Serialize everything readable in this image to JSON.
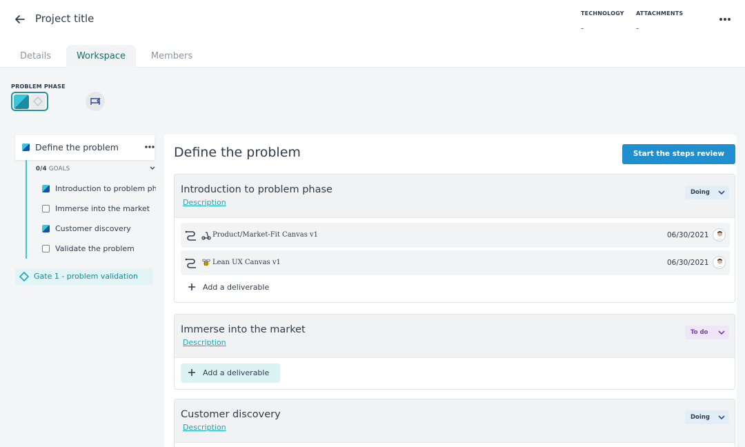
{
  "header": {
    "title": "Project title",
    "technology_label": "TECHNOLOGY",
    "technology_value": "-",
    "attachments_label": "ATTACHMENTS",
    "attachments_value": "-"
  },
  "tabs": [
    {
      "label": "Details",
      "active": false
    },
    {
      "label": "Workspace",
      "active": true
    },
    {
      "label": "Members",
      "active": false
    }
  ],
  "phase": {
    "label": "PROBLEM PHASE"
  },
  "sidebar": {
    "current_step": "Define the problem",
    "goals_count": "0/4",
    "goals_label": "GOALS",
    "goals": [
      {
        "label": "Introduction to problem phase",
        "state": "done"
      },
      {
        "label": "Immerse into the market",
        "state": "todo"
      },
      {
        "label": "Customer discovery",
        "state": "done"
      },
      {
        "label": "Validate the problem",
        "state": "todo"
      }
    ],
    "gate": "Gate 1 - problem validation"
  },
  "main": {
    "title": "Define the problem",
    "review_button": "Start the steps review",
    "cards": [
      {
        "title": "Introduction to problem phase",
        "description_link": "Description",
        "status": "Doing",
        "deliverables": [
          {
            "name": "Product/Market-Fit Canvas v1",
            "date": "06/30/2021",
            "icon": "scooter-icon"
          },
          {
            "name": "Lean UX Canvas v1",
            "date": "06/30/2021",
            "icon": "bee-icon"
          }
        ],
        "add_label": "Add a deliverable"
      },
      {
        "title": "Immerse into the market",
        "description_link": "Description",
        "status": "To do",
        "add_label": "Add a deliverable"
      },
      {
        "title": "Customer discovery",
        "description_link": "Description",
        "status": "Doing"
      }
    ]
  },
  "colors": {
    "accent": "#1f8fd0",
    "teal": "#1aa6b4",
    "doing_bg": "#e1eef8",
    "todo_bg": "#eee6f6",
    "todo_text": "#7a3fa8"
  }
}
